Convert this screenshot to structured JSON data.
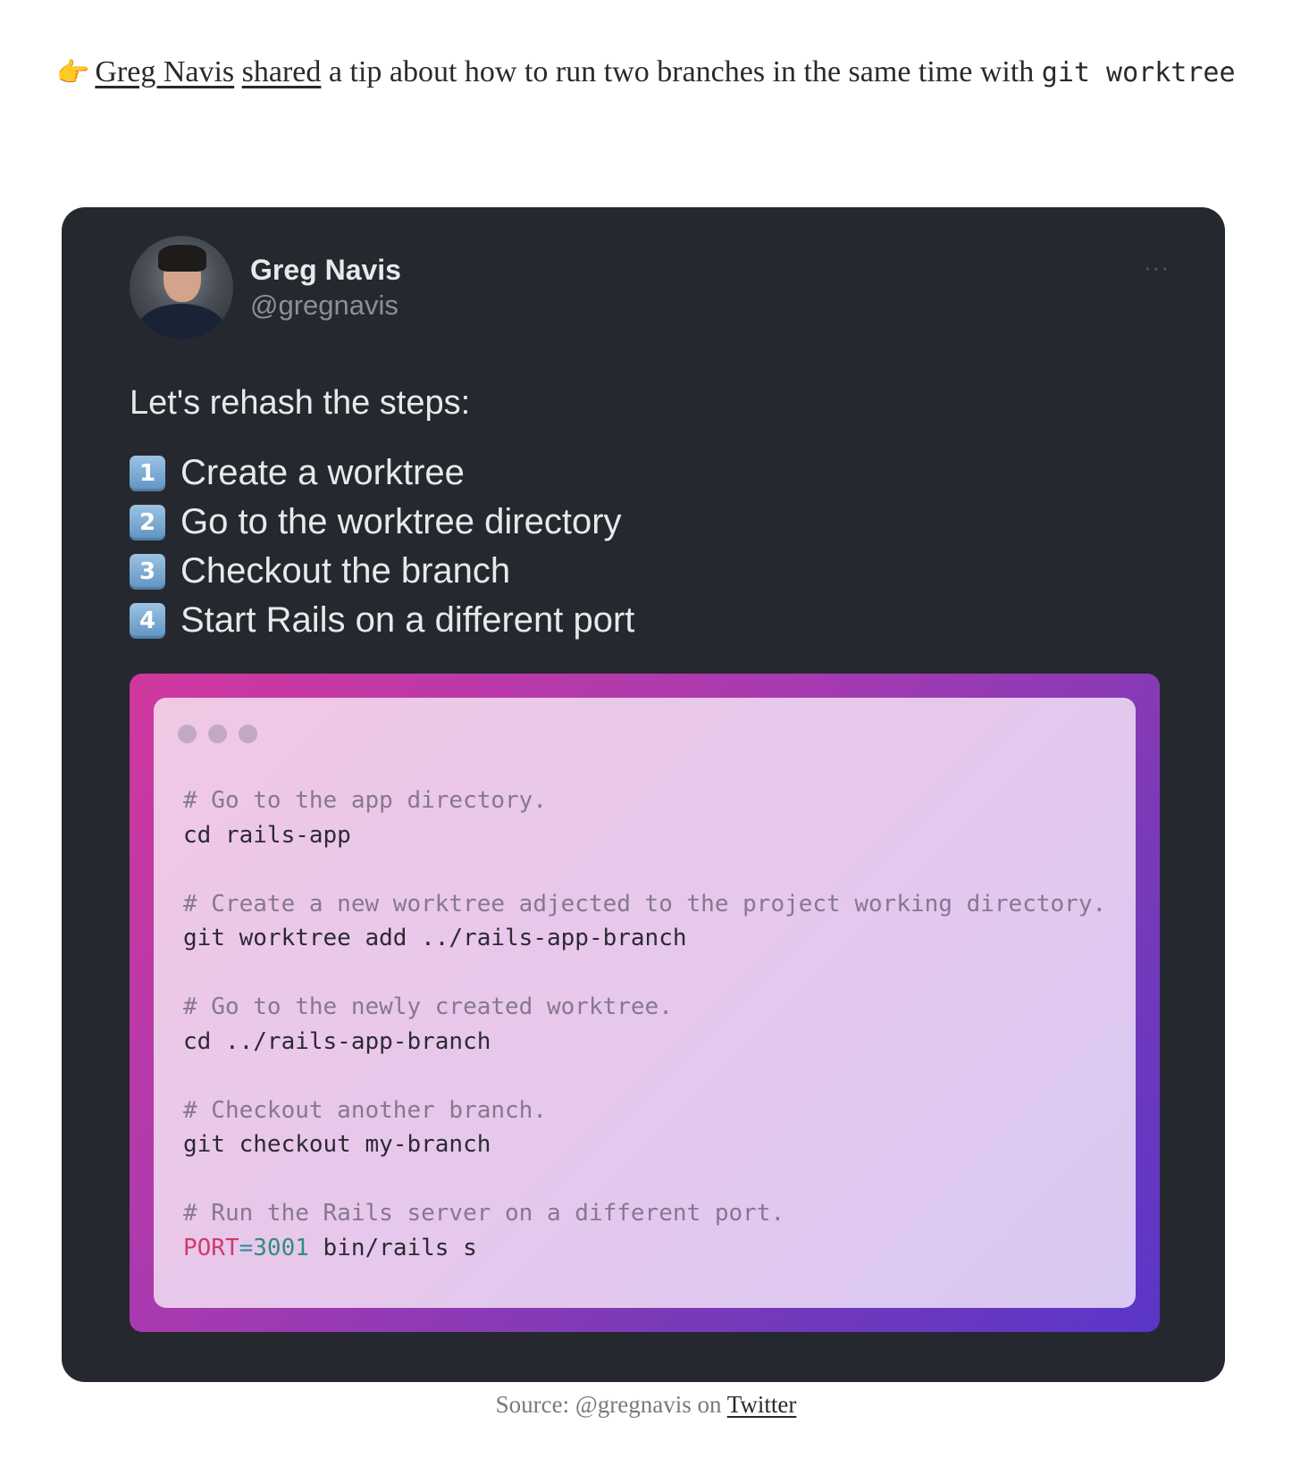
{
  "intro": {
    "emoji": "👉",
    "author_link": "Greg Navis",
    "shared_link": "shared",
    "text": " a tip about how to run two branches in the same time with ",
    "code": "git worktree"
  },
  "tweet": {
    "name": "Greg Navis",
    "handle": "@gregnavis",
    "more": "···",
    "intro": "Let's rehash the steps:",
    "steps": [
      {
        "num": "1",
        "text": "Create a worktree"
      },
      {
        "num": "2",
        "text": "Go to the worktree directory"
      },
      {
        "num": "3",
        "text": "Checkout the branch"
      },
      {
        "num": "4",
        "text": "Start Rails on a different port"
      }
    ],
    "code": {
      "c1": "# Go to the app directory.",
      "l1": "cd rails-app",
      "c2": "# Create a new worktree adjected to the project working directory.",
      "l2": "git worktree add ../rails-app-branch",
      "c3": "# Go to the newly created worktree.",
      "l3": "cd ../rails-app-branch",
      "c4": "# Checkout another branch.",
      "l4": "git checkout my-branch",
      "c5": "# Run the Rails server on a different port.",
      "l5_var": "PORT",
      "l5_eq": "=",
      "l5_num": "3001",
      "l5_rest": " bin/rails s"
    }
  },
  "caption": {
    "text": "Source: @gregnavis on ",
    "link": "Twitter"
  }
}
